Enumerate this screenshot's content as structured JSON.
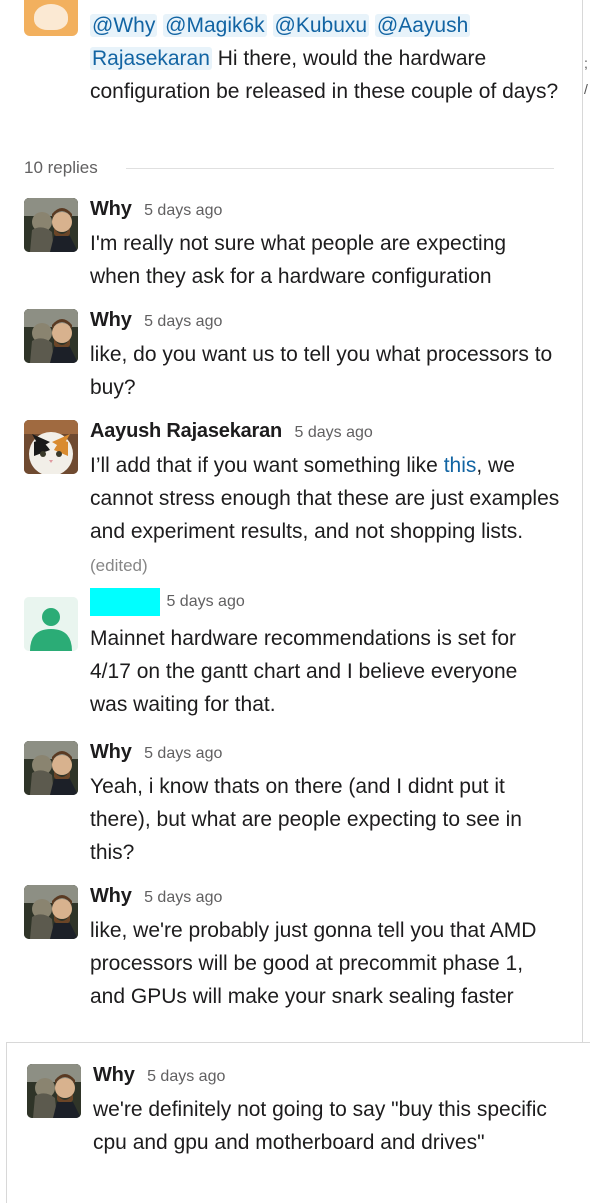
{
  "parent": {
    "mentions": [
      "@Why",
      "@Magik6k",
      "@Kubuxu",
      "@Aayush",
      "Rajasekaran"
    ],
    "text": "Hi there, would the hardware configuration be released in these couple of days?"
  },
  "replies": {
    "label": "10 replies"
  },
  "messages": [
    {
      "name": "Why",
      "time": "5 days ago",
      "avatar": "why",
      "text": "I'm really not sure what people are expecting when they ask for a hardware configuration"
    },
    {
      "name": "Why",
      "time": "5 days ago",
      "avatar": "why",
      "text": "like, do you want us to tell you what processors to buy?"
    },
    {
      "name": "Aayush Rajasekaran",
      "time": "5 days ago",
      "avatar": "cat",
      "text_before": "I’ll add that if you want something like ",
      "link": "this",
      "text_after": ", we cannot stress enough that these are just examples and experiment results, and not shopping lists.",
      "edited": "(edited)"
    },
    {
      "name": "",
      "time": "5 days ago",
      "avatar": "generic",
      "redacted": true,
      "text": "Mainnet hardware recommendations is set for 4/17 on the gantt chart and I believe everyone was waiting for that."
    },
    {
      "name": "Why",
      "time": "5 days ago",
      "avatar": "why",
      "text": "Yeah, i know thats on there (and I didnt put it there), but what are people expecting to see in this?"
    },
    {
      "name": "Why",
      "time": "5 days ago",
      "avatar": "why",
      "text": "like, we're probably just gonna tell you that AMD processors will be good at precommit phase 1, and GPUs will make your snark sealing faster"
    },
    {
      "name": "Why",
      "time": "5 days ago",
      "avatar": "why",
      "text": "we're definitely not going to say \"buy this specific cpu and gpu and motherboard and drives\""
    }
  ],
  "colors": {
    "mention": "#1264a3",
    "mention_bg": "#e8f3fa",
    "link": "#1264a3",
    "redaction": "#00ffff",
    "generic_avatar": "#2bac76"
  }
}
